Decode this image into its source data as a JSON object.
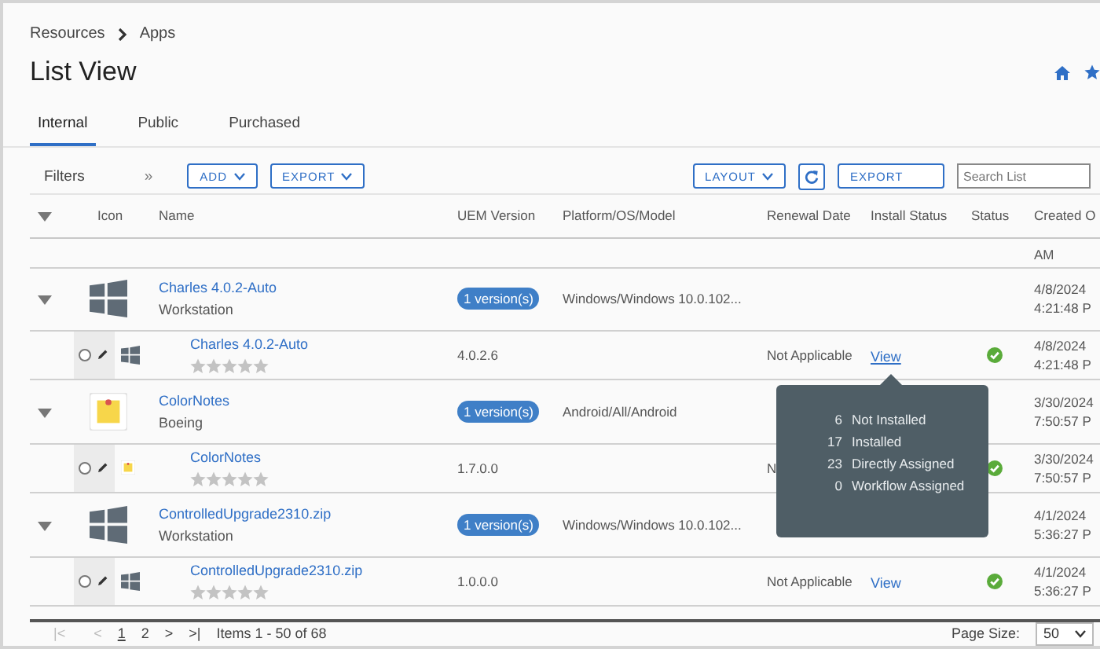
{
  "breadcrumb": [
    "Resources",
    "Apps"
  ],
  "title": "List View",
  "tabs": [
    {
      "label": "Internal",
      "selected": true
    },
    {
      "label": "Public",
      "selected": false
    },
    {
      "label": "Purchased",
      "selected": false
    }
  ],
  "toolbar": {
    "filters": "Filters",
    "expand": "»",
    "add": "ADD",
    "export_menu": "EXPORT",
    "layout": "LAYOUT",
    "export": "EXPORT",
    "search": {
      "placeholder": "Search List"
    }
  },
  "columns": [
    "Icon",
    "Name",
    "UEM Version",
    "Platform/OS/Model",
    "Renewal Date",
    "Install Status",
    "Status",
    "Created O"
  ],
  "partial_row": {
    "created": "AM"
  },
  "groups": [
    {
      "name": "Charles 4.0.2-Auto",
      "subtitle": "Workstation",
      "kind": "windows",
      "versions": "1 version(s)",
      "platform": "Windows/Windows 10.0.102...",
      "created": "4/8/2024\n4:21:48 P",
      "child": {
        "name": "Charles 4.0.2-Auto",
        "kind": "windows",
        "selected": false,
        "stars": 0,
        "version": "4.0.2.6",
        "renewal": "Not Applicable",
        "install": {
          "text": "View",
          "underlined": true
        },
        "status_ok": true,
        "created": "4/8/2024\n4:21:48 P"
      }
    },
    {
      "name": "ColorNotes",
      "subtitle": "Boeing",
      "kind": "notes",
      "versions": "1 version(s)",
      "platform": "Android/All/Android",
      "created": "3/30/2024\n7:50:57 P",
      "child": {
        "name": "ColorNotes",
        "kind": "notes",
        "selected": false,
        "stars": 0,
        "version": "1.7.0.0",
        "renewal": "N",
        "status_ok": true,
        "created": "3/30/2024\n7:50:57 P"
      }
    },
    {
      "name": "ControlledUpgrade2310.zip",
      "subtitle": "Workstation",
      "kind": "windows",
      "versions": "1 version(s)",
      "platform": "Windows/Windows 10.0.102...",
      "created": "4/1/2024\n5:36:27 P",
      "child": {
        "name": "ControlledUpgrade2310.zip",
        "kind": "windows",
        "selected": false,
        "stars": 0,
        "version": "1.0.0.0",
        "renewal": "Not Applicable",
        "install": {
          "text": "View",
          "underlined": false
        },
        "status_ok": true,
        "created": "4/1/2024\n5:36:27 P"
      }
    }
  ],
  "popover": [
    {
      "count": "6",
      "label": "Not Installed"
    },
    {
      "count": "17",
      "label": "Installed"
    },
    {
      "count": "23",
      "label": "Directly Assigned"
    },
    {
      "count": "0",
      "label": "Workflow Assigned"
    }
  ],
  "pager": {
    "first": "|<",
    "prev": "<",
    "pages": [
      {
        "label": "1",
        "selected": true
      },
      {
        "label": "2",
        "selected": false
      }
    ],
    "next": ">",
    "last": ">|",
    "summary": "Items 1 - 50 of 68"
  },
  "page_size": {
    "label": "Page Size:",
    "value": "50"
  }
}
